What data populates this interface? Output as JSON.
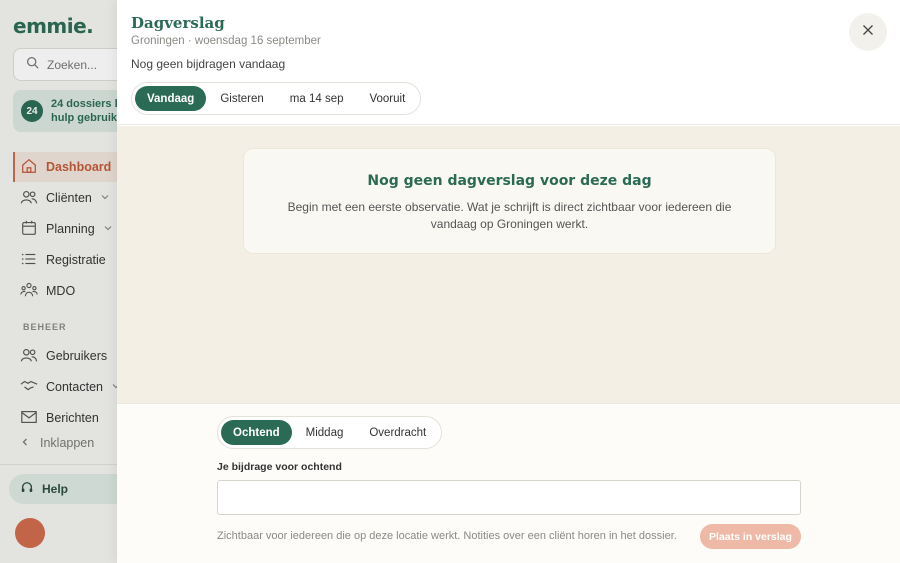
{
  "app": {
    "logo": "emmie."
  },
  "sidebar": {
    "search_placeholder": "Zoeken...",
    "dossier_count": "24",
    "dossier_line1": "24 dossiers k",
    "dossier_line2": "hulp gebruike",
    "items": [
      {
        "label": "Dashboard",
        "icon": "home-icon"
      },
      {
        "label": "Cliënten",
        "icon": "users-icon"
      },
      {
        "label": "Planning",
        "icon": "calendar-icon"
      },
      {
        "label": "Registratie",
        "icon": "list-icon"
      },
      {
        "label": "MDO",
        "icon": "group-icon"
      }
    ],
    "section_beheer": "BEHEER",
    "beheer_items": [
      {
        "label": "Gebruikers",
        "icon": "users-icon"
      },
      {
        "label": "Contacten",
        "icon": "handshake-icon"
      },
      {
        "label": "Berichten",
        "icon": "mail-icon"
      }
    ],
    "collapse_label": "Inklappen",
    "help_label": "Help"
  },
  "panel": {
    "title": "Dagverslag",
    "subtitle": "Groningen · woensdag 16 september",
    "status": "Nog geen bijdragen vandaag",
    "day_tabs": [
      "Vandaag",
      "Gisteren",
      "ma 14 sep",
      "Vooruit"
    ],
    "empty_title": "Nog geen dagverslag voor deze dag",
    "empty_desc": "Begin met een eerste observatie. Wat je schrijft is direct zichtbaar voor iedereen die vandaag op Groningen werkt.",
    "shift_tabs": [
      "Ochtend",
      "Middag",
      "Overdracht"
    ],
    "field_label": "Je bijdrage voor ochtend",
    "field_value": "",
    "hint": "Zichtbaar voor iedereen die op deze locatie werkt. Notities over een cliënt horen in het dossier.",
    "post_button": "Plaats in verslag"
  },
  "colors": {
    "brand": "#2b6b55",
    "accent": "#c96d4a",
    "disabled_button": "#eeb9a6"
  }
}
